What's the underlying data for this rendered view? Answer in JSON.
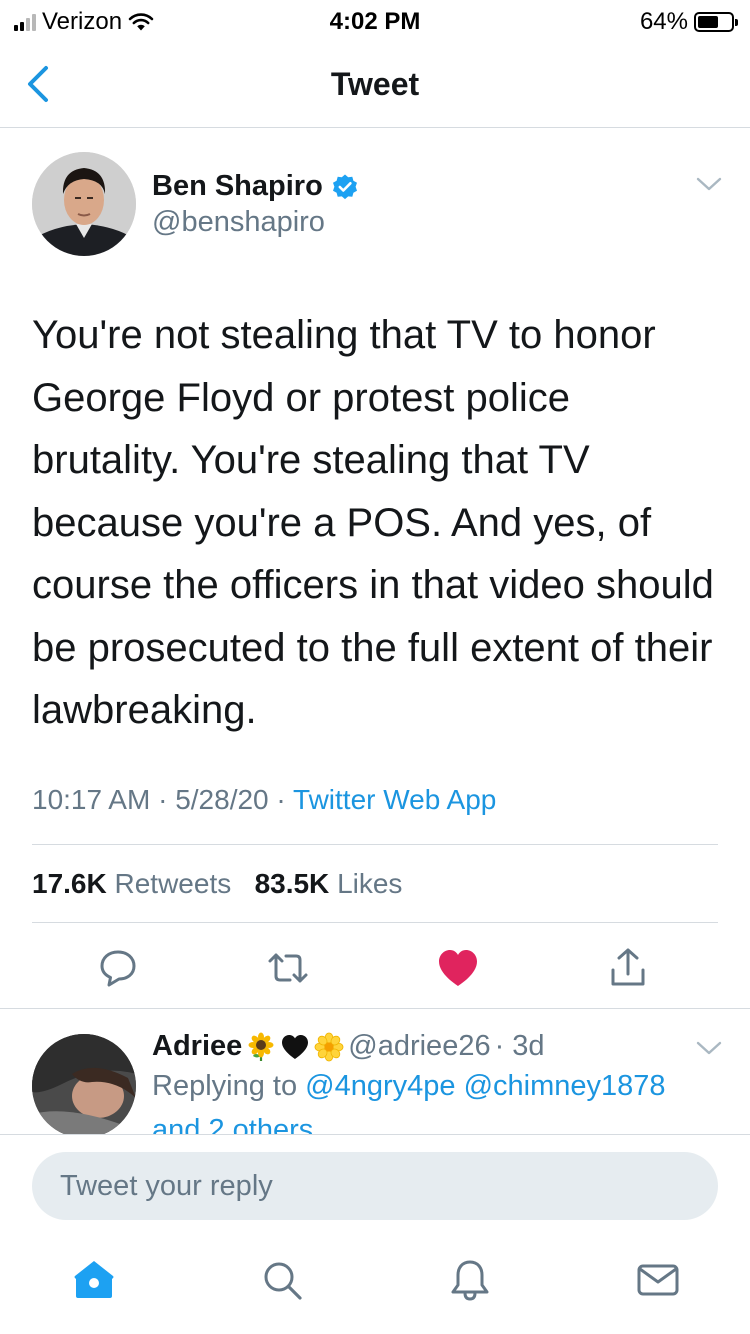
{
  "status_bar": {
    "carrier": "Verizon",
    "time": "4:02 PM",
    "battery_percent": "64%",
    "battery_level": 0.64,
    "signal_bars": 2
  },
  "nav": {
    "title": "Tweet",
    "back_icon": "chevron-left-icon"
  },
  "tweet": {
    "author_name": "Ben Shapiro",
    "author_handle": "@benshapiro",
    "verified": true,
    "text": "You're not stealing that TV to honor George Floyd or protest police brutality. You're stealing that TV because you're a POS. And yes, of course the officers in that video should be prosecuted to the full extent of their lawbreaking.",
    "time": "10:17 AM",
    "date": "5/28/20",
    "separator": "·",
    "source": "Twitter Web App",
    "retweets_count": "17.6K",
    "retweets_label": "Retweets",
    "likes_count": "83.5K",
    "likes_label": "Likes",
    "liked": true
  },
  "reply": {
    "author_name": "Adriee",
    "emojis": [
      "sunflower-emoji",
      "black-heart-emoji",
      "blossom-emoji"
    ],
    "handle": "@adriee26",
    "age": "· 3d",
    "replying_prefix": "Replying to",
    "mention_1": "@4ngry4pe",
    "mention_2": "@chimney1878",
    "others": "and 2 others"
  },
  "composer": {
    "placeholder": "Tweet your reply"
  },
  "tabs": [
    "home-icon",
    "search-icon",
    "notifications-icon",
    "messages-icon"
  ],
  "colors": {
    "accent": "#1b95e0",
    "like": "#e0245e",
    "secondary_text": "#657786"
  }
}
